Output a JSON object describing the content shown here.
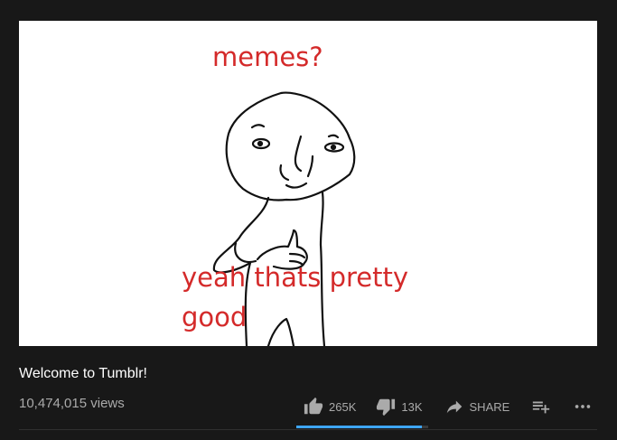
{
  "video": {
    "meme_top": "memes?",
    "meme_bottom_line1": "yeah thats pretty",
    "meme_bottom_line2": "good",
    "title": "Welcome to Tumblr!",
    "views": "10,474,015 views"
  },
  "actions": {
    "like_count": "265K",
    "dislike_count": "13K",
    "share_label": "SHARE"
  },
  "sentiment": {
    "like_ratio": 0.953
  },
  "icons": {
    "like": "thumb-up-icon",
    "dislike": "thumb-down-icon",
    "share": "share-arrow-icon",
    "save": "playlist-add-icon",
    "more": "more-horizontal-icon"
  },
  "colors": {
    "accent": "#3ea6ff",
    "meme_text": "#d42a2a",
    "background": "#181818"
  }
}
